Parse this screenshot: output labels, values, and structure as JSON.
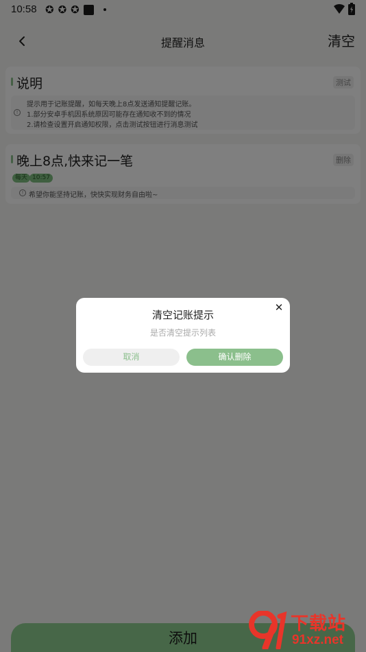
{
  "status_bar": {
    "time": "10:58",
    "left_icons": [
      "app-notification-icon",
      "app-notification-icon",
      "app-notification-icon",
      "square-icon",
      "dot-icon"
    ],
    "right_icons": [
      "wifi-icon",
      "battery-icon"
    ]
  },
  "header": {
    "title": "提醒消息",
    "clear_label": "清空"
  },
  "explanation_card": {
    "title": "说明",
    "tag": "测试",
    "lines": [
      "提示用于记账提醒，如每天晚上8点发送通知提醒记账。",
      "1.部分安卓手机因系统原因可能存在通知收不到的情况",
      "2.请检查设置开启通知权限，点击测试按钮进行消息测试"
    ]
  },
  "reminder_card": {
    "title": "晚上8点,快来记一笔",
    "tag": "删除",
    "repeat": "每天",
    "time": "10:57",
    "note": "希望你能坚持记账，快快实现财务自由啦~"
  },
  "add_button": {
    "label": "添加"
  },
  "dialog": {
    "title": "清空记账提示",
    "subtitle": "是否清空提示列表",
    "cancel_label": "取消",
    "confirm_label": "确认删除"
  },
  "watermark": {
    "title": "下载站",
    "domain": "91xz.net"
  },
  "colors": {
    "accent": "#8bbf8c",
    "add_button": "#8fcf90",
    "overlay": "rgba(0,0,0,0.5)",
    "watermark": "#e8352a"
  }
}
